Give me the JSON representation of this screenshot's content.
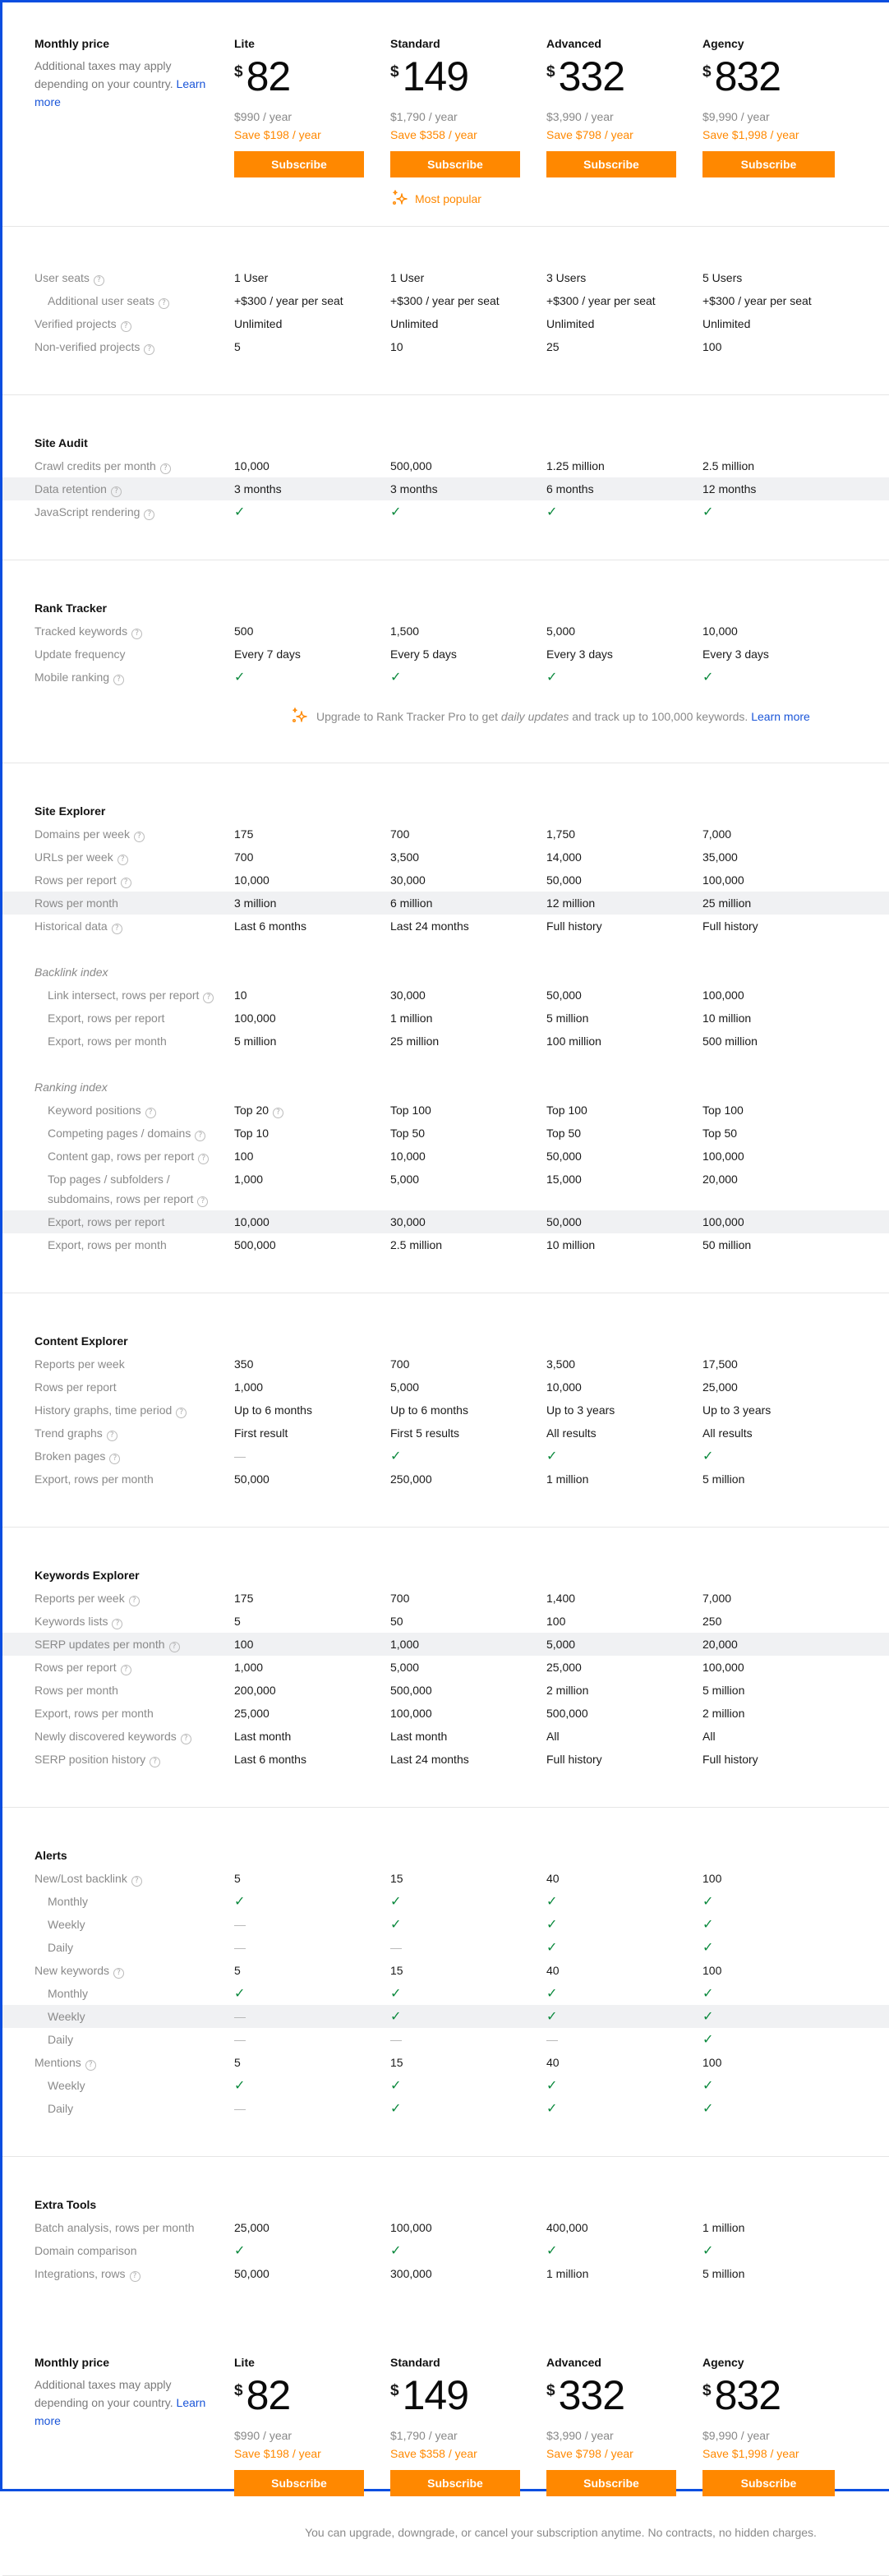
{
  "colors": {
    "accent": "#ff8800",
    "link": "#1a55d8",
    "check": "#0c8a3e",
    "frame": "#0b4ee0"
  },
  "pricing": {
    "title": "Monthly price",
    "note": "Additional taxes may apply depending on your country.",
    "learn_more": "Learn more",
    "currency": "$",
    "plans": [
      {
        "name": "Lite",
        "price": "82",
        "yearly": "$990 / year",
        "save": "Save $198 / year",
        "cta": "Subscribe"
      },
      {
        "name": "Standard",
        "price": "149",
        "yearly": "$1,790 / year",
        "save": "Save $358 / year",
        "cta": "Subscribe"
      },
      {
        "name": "Advanced",
        "price": "332",
        "yearly": "$3,990 / year",
        "save": "Save $798 / year",
        "cta": "Subscribe"
      },
      {
        "name": "Agency",
        "price": "832",
        "yearly": "$9,990 / year",
        "save": "Save $1,998 / year",
        "cta": "Subscribe"
      }
    ],
    "most_popular": "Most popular",
    "most_popular_icon": "sparkle-icon"
  },
  "help_icon": "?",
  "check_glyph": "✓",
  "dash_glyph": "—",
  "sections": [
    {
      "id": "account",
      "title": "",
      "groups": [
        {
          "subtitle": "",
          "rows": [
            {
              "label": "User seats",
              "help": true,
              "values": [
                "1 User",
                "1 User",
                "3 Users",
                "5 Users"
              ]
            },
            {
              "label": "Additional user seats",
              "help": true,
              "indent": true,
              "values": [
                "+$300 / year per seat",
                "+$300 / year per seat",
                "+$300 / year per seat",
                "+$300 / year per seat"
              ]
            },
            {
              "label": "Verified projects",
              "help": true,
              "values": [
                "Unlimited",
                "Unlimited",
                "Unlimited",
                "Unlimited"
              ]
            },
            {
              "label": "Non-verified projects",
              "help": true,
              "values": [
                "5",
                "10",
                "25",
                "100"
              ]
            }
          ]
        }
      ]
    },
    {
      "id": "site-audit",
      "title": "Site Audit",
      "groups": [
        {
          "subtitle": "",
          "rows": [
            {
              "label": "Crawl credits per month",
              "help": true,
              "values": [
                "10,000",
                "500,000",
                "1.25 million",
                "2.5 million"
              ]
            },
            {
              "label": "Data retention",
              "help": true,
              "shaded": true,
              "values": [
                "3 months",
                "3 months",
                "6 months",
                "12 months"
              ]
            },
            {
              "label": "JavaScript rendering",
              "help": true,
              "values": [
                "check",
                "check",
                "check",
                "check"
              ]
            }
          ]
        }
      ]
    },
    {
      "id": "rank-tracker",
      "title": "Rank Tracker",
      "groups": [
        {
          "subtitle": "",
          "rows": [
            {
              "label": "Tracked keywords",
              "help": true,
              "values": [
                "500",
                "1,500",
                "5,000",
                "10,000"
              ]
            },
            {
              "label": "Update frequency",
              "help": false,
              "values": [
                "Every 7 days",
                "Every 5 days",
                "Every 3 days",
                "Every 3 days"
              ]
            },
            {
              "label": "Mobile ranking",
              "help": true,
              "values": [
                "check",
                "check",
                "check",
                "check"
              ]
            }
          ]
        }
      ],
      "upgrade_note": {
        "prefix": "Upgrade to Rank Tracker Pro to get ",
        "emphasis": "daily updates",
        "suffix": " and track up to 100,000 keywords. ",
        "link": "Learn more"
      }
    },
    {
      "id": "site-explorer",
      "title": "Site Explorer",
      "groups": [
        {
          "subtitle": "",
          "rows": [
            {
              "label": "Domains per week",
              "help": true,
              "values": [
                "175",
                "700",
                "1,750",
                "7,000"
              ]
            },
            {
              "label": "URLs per week",
              "help": true,
              "values": [
                "700",
                "3,500",
                "14,000",
                "35,000"
              ]
            },
            {
              "label": "Rows per report",
              "help": true,
              "values": [
                "10,000",
                "30,000",
                "50,000",
                "100,000"
              ]
            },
            {
              "label": "Rows per month",
              "help": false,
              "shaded": true,
              "values": [
                "3 million",
                "6 million",
                "12 million",
                "25 million"
              ]
            },
            {
              "label": "Historical data",
              "help": true,
              "values": [
                "Last 6 months",
                "Last 24 months",
                "Full history",
                "Full history"
              ]
            }
          ]
        },
        {
          "subtitle": "Backlink index",
          "rows": [
            {
              "label": "Link intersect, rows per report",
              "help": true,
              "indent": true,
              "values": [
                "10",
                "30,000",
                "50,000",
                "100,000"
              ]
            },
            {
              "label": "Export, rows per report",
              "help": false,
              "indent": true,
              "values": [
                "100,000",
                "1 million",
                "5 million",
                "10 million"
              ]
            },
            {
              "label": "Export, rows per month",
              "help": false,
              "indent": true,
              "values": [
                "5 million",
                "25 million",
                "100 million",
                "500 million"
              ]
            }
          ]
        },
        {
          "subtitle": "Ranking index",
          "rows": [
            {
              "label": "Keyword positions",
              "help": true,
              "indent": true,
              "values": [
                "Top 20",
                "Top 100",
                "Top 100",
                "Top 100"
              ],
              "value_help": [
                true,
                false,
                false,
                false
              ]
            },
            {
              "label": "Competing pages / domains",
              "help": true,
              "indent": true,
              "values": [
                "Top 10",
                "Top 50",
                "Top 50",
                "Top 50"
              ]
            },
            {
              "label": "Content gap, rows per report",
              "help": true,
              "indent": true,
              "values": [
                "100",
                "10,000",
                "50,000",
                "100,000"
              ]
            },
            {
              "label": "Top pages / subfolders / subdomains, rows per report",
              "help": true,
              "indent": true,
              "tall": true,
              "values": [
                "1,000",
                "5,000",
                "15,000",
                "20,000"
              ]
            },
            {
              "label": "Export, rows per report",
              "help": false,
              "indent": true,
              "shaded": true,
              "values": [
                "10,000",
                "30,000",
                "50,000",
                "100,000"
              ]
            },
            {
              "label": "Export, rows per month",
              "help": false,
              "indent": true,
              "values": [
                "500,000",
                "2.5 million",
                "10 million",
                "50 million"
              ]
            }
          ]
        }
      ]
    },
    {
      "id": "content-explorer",
      "title": "Content Explorer",
      "groups": [
        {
          "subtitle": "",
          "rows": [
            {
              "label": "Reports per week",
              "help": false,
              "values": [
                "350",
                "700",
                "3,500",
                "17,500"
              ]
            },
            {
              "label": "Rows per report",
              "help": false,
              "values": [
                "1,000",
                "5,000",
                "10,000",
                "25,000"
              ]
            },
            {
              "label": "History graphs, time period",
              "help": true,
              "values": [
                "Up to 6 months",
                "Up to 6 months",
                "Up to 3 years",
                "Up to 3 years"
              ]
            },
            {
              "label": "Trend graphs",
              "help": true,
              "values": [
                "First result",
                "First 5 results",
                "All results",
                "All results"
              ]
            },
            {
              "label": "Broken pages",
              "help": true,
              "values": [
                "dash",
                "check",
                "check",
                "check"
              ]
            },
            {
              "label": "Export, rows per month",
              "help": false,
              "values": [
                "50,000",
                "250,000",
                "1 million",
                "5 million"
              ]
            }
          ]
        }
      ]
    },
    {
      "id": "keywords-explorer",
      "title": "Keywords Explorer",
      "groups": [
        {
          "subtitle": "",
          "rows": [
            {
              "label": "Reports per week",
              "help": true,
              "values": [
                "175",
                "700",
                "1,400",
                "7,000"
              ]
            },
            {
              "label": "Keywords lists",
              "help": true,
              "values": [
                "5",
                "50",
                "100",
                "250"
              ]
            },
            {
              "label": "SERP updates per month",
              "help": true,
              "shaded": true,
              "values": [
                "100",
                "1,000",
                "5,000",
                "20,000"
              ]
            },
            {
              "label": "Rows per report",
              "help": true,
              "values": [
                "1,000",
                "5,000",
                "25,000",
                "100,000"
              ]
            },
            {
              "label": "Rows per month",
              "help": false,
              "values": [
                "200,000",
                "500,000",
                "2 million",
                "5 million"
              ]
            },
            {
              "label": "Export, rows per month",
              "help": false,
              "values": [
                "25,000",
                "100,000",
                "500,000",
                "2 million"
              ]
            },
            {
              "label": "Newly discovered keywords",
              "help": true,
              "values": [
                "Last month",
                "Last month",
                "All",
                "All"
              ]
            },
            {
              "label": "SERP position history",
              "help": true,
              "values": [
                "Last 6 months",
                "Last 24 months",
                "Full history",
                "Full history"
              ]
            }
          ]
        }
      ]
    },
    {
      "id": "alerts",
      "title": "Alerts",
      "groups": [
        {
          "subtitle": "",
          "rows": [
            {
              "label": "New/Lost backlink",
              "help": true,
              "values": [
                "5",
                "15",
                "40",
                "100"
              ]
            },
            {
              "label": "Monthly",
              "help": false,
              "indent": true,
              "values": [
                "check",
                "check",
                "check",
                "check"
              ]
            },
            {
              "label": "Weekly",
              "help": false,
              "indent": true,
              "values": [
                "dash",
                "check",
                "check",
                "check"
              ]
            },
            {
              "label": "Daily",
              "help": false,
              "indent": true,
              "values": [
                "dash",
                "dash",
                "check",
                "check"
              ]
            },
            {
              "label": "New keywords",
              "help": true,
              "values": [
                "5",
                "15",
                "40",
                "100"
              ]
            },
            {
              "label": "Monthly",
              "help": false,
              "indent": true,
              "values": [
                "check",
                "check",
                "check",
                "check"
              ]
            },
            {
              "label": "Weekly",
              "help": false,
              "indent": true,
              "shaded": true,
              "values": [
                "dash",
                "check",
                "check",
                "check"
              ]
            },
            {
              "label": "Daily",
              "help": false,
              "indent": true,
              "values": [
                "dash",
                "dash",
                "dash",
                "check"
              ]
            },
            {
              "label": "Mentions",
              "help": true,
              "values": [
                "5",
                "15",
                "40",
                "100"
              ]
            },
            {
              "label": "Weekly",
              "help": false,
              "indent": true,
              "values": [
                "check",
                "check",
                "check",
                "check"
              ]
            },
            {
              "label": "Daily",
              "help": false,
              "indent": true,
              "values": [
                "dash",
                "check",
                "check",
                "check"
              ]
            }
          ]
        }
      ]
    },
    {
      "id": "extra-tools",
      "title": "Extra Tools",
      "groups": [
        {
          "subtitle": "",
          "rows": [
            {
              "label": "Batch analysis, rows per month",
              "help": false,
              "values": [
                "25,000",
                "100,000",
                "400,000",
                "1 million"
              ]
            },
            {
              "label": "Domain comparison",
              "help": false,
              "values": [
                "check",
                "check",
                "check",
                "check"
              ]
            },
            {
              "label": "Integrations, rows",
              "help": true,
              "values": [
                "50,000",
                "300,000",
                "1 million",
                "5 million"
              ]
            }
          ]
        }
      ]
    }
  ],
  "footer_note": "You can upgrade, downgrade, or cancel your subscription anytime. No contracts, no hidden charges."
}
